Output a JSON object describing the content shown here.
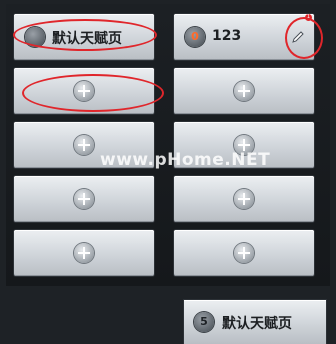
{
  "slots": {
    "slot1": {
      "number": "",
      "label": "默认天赋页"
    },
    "slot2": {
      "number": "0",
      "label": "123",
      "edit_badge": "1"
    }
  },
  "watermark": "www.pHome.NET",
  "footer": {
    "number": "5",
    "label": "默认天赋页"
  },
  "colors": {
    "highlight": "#e0262b",
    "slot_face": "#d6dadf",
    "background": "#1e2226"
  },
  "icons": {
    "add": "plus-circle-icon",
    "edit": "pencil-icon"
  }
}
